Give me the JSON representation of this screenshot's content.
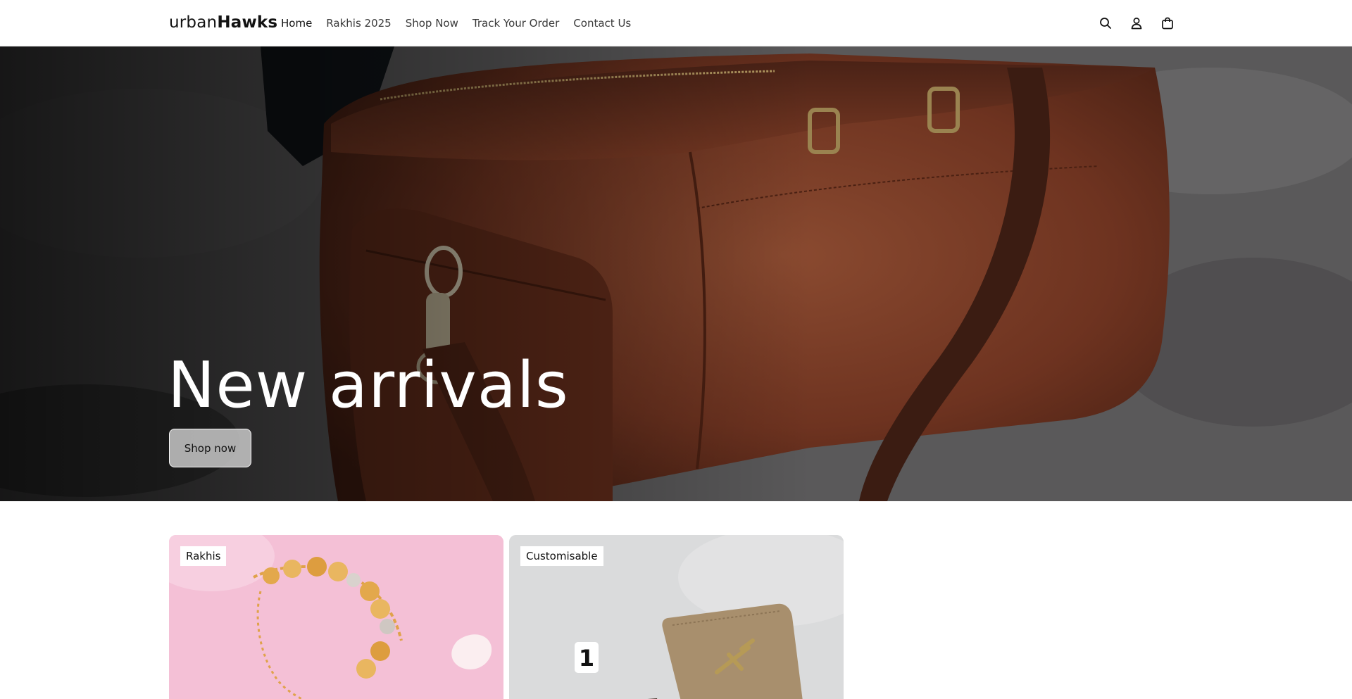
{
  "header": {
    "logo_light": "urban",
    "logo_bold": "Hawks",
    "nav": [
      {
        "label": "Home"
      },
      {
        "label": "Rakhis 2025"
      },
      {
        "label": "Shop Now"
      },
      {
        "label": "Track Your Order"
      },
      {
        "label": "Contact Us"
      }
    ],
    "icons": [
      "search-icon",
      "account-icon",
      "cart-icon"
    ]
  },
  "hero": {
    "title": "New arrivals",
    "button_label": "Shop now"
  },
  "collections": [
    {
      "label": "Rakhis"
    },
    {
      "label": "Customisable"
    }
  ],
  "colors": {
    "leather": "#6e3320",
    "stone": "#555455",
    "rakhi_bg": "#f4c0d6"
  }
}
